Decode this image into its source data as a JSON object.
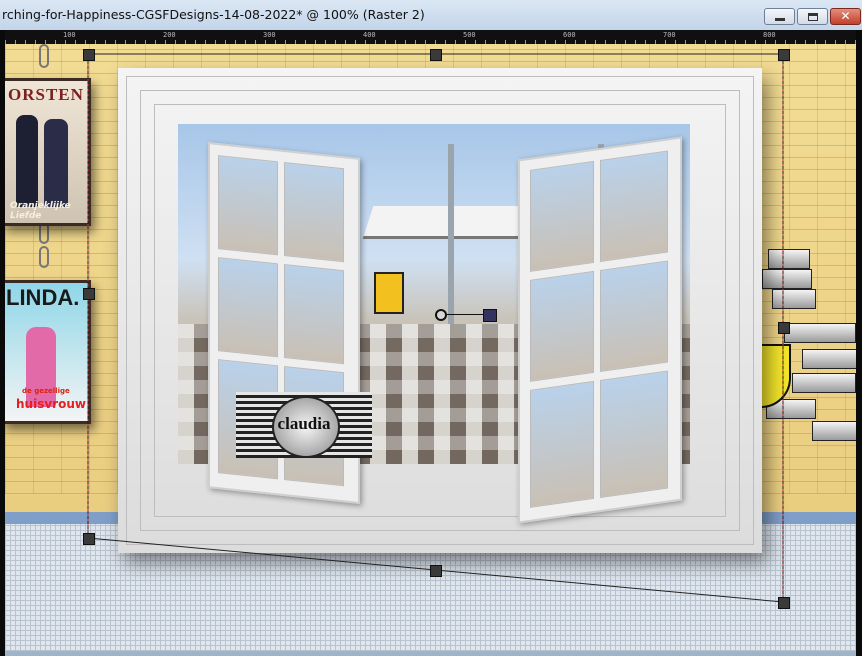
{
  "window": {
    "title": "rching-for-Happiness-CGSFDesigns-14-08-2022* @ 100% (Raster 2)",
    "controls": {
      "minimize": "minimize",
      "maximize": "maximize",
      "close": "✕"
    }
  },
  "ruler": {
    "labels": [
      "100",
      "200",
      "300",
      "400",
      "500",
      "600",
      "700",
      "800"
    ]
  },
  "canvas": {
    "magazine_top": {
      "title": "ORSTEN",
      "subtitle": "Oranjeklijke Liefde"
    },
    "magazine_bottom": {
      "title": "LINDA.",
      "subtitle": "huisvrouw",
      "tag": "de gezellige"
    },
    "watermark": "claudia"
  },
  "colors": {
    "titlebar": "#c3d5ea",
    "ruler": "#101010",
    "floor_band": "#7f9ec8",
    "wall": "#e7c97a",
    "close_button": "#c1402a"
  }
}
